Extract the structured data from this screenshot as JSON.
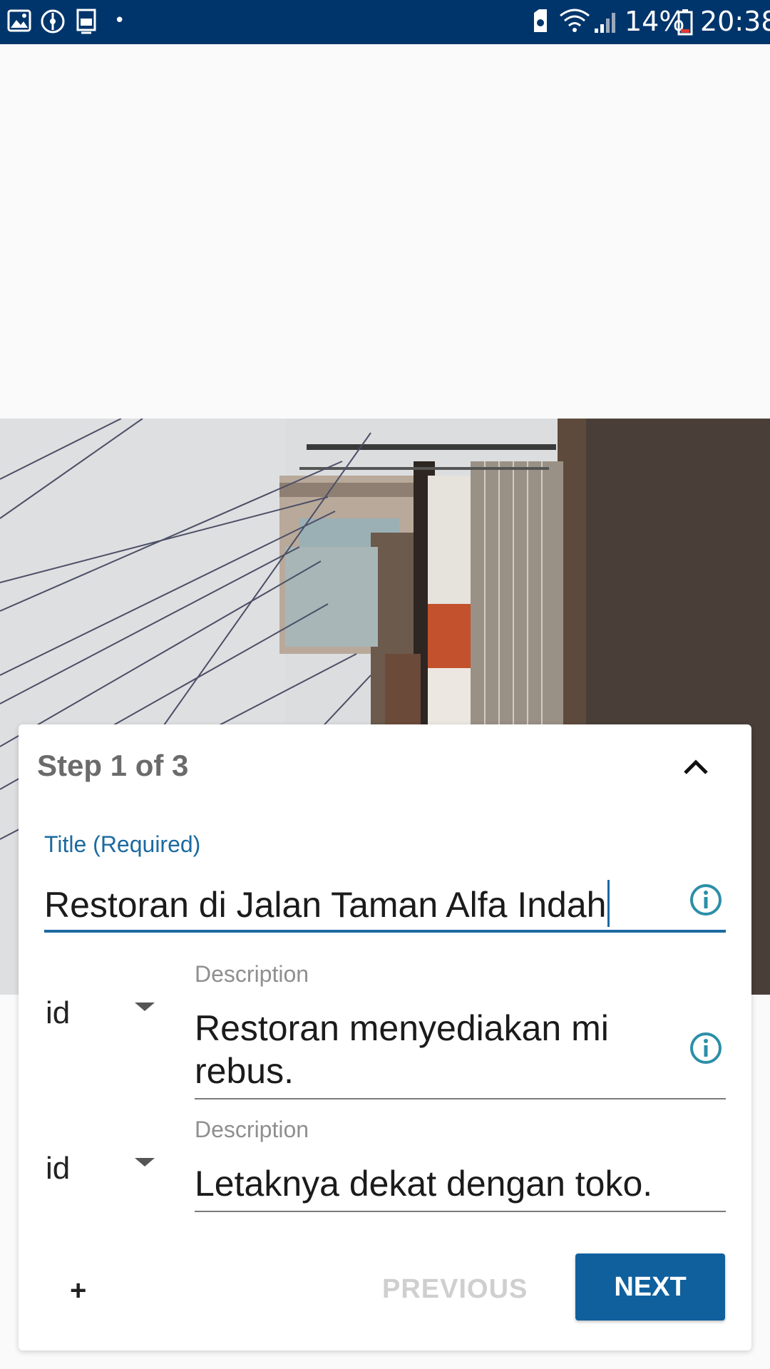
{
  "status_bar": {
    "battery": "14%",
    "time": "20:38",
    "dot": "•",
    "icons": [
      "image-icon",
      "compass-icon",
      "font-icon",
      "sim-icon",
      "wifi-icon",
      "signal-icon",
      "battery-icon"
    ]
  },
  "card": {
    "step": "Step 1 of 3",
    "title_field": {
      "label": "Title (Required)",
      "value": "Restoran di Jalan Taman Alfa Indah"
    },
    "descriptions": [
      {
        "language": "id",
        "label": "Description",
        "value": "Restoran menyediakan mi rebus."
      },
      {
        "language": "id",
        "label": "Description",
        "value": "Letaknya dekat dengan toko."
      }
    ],
    "add_label": "+",
    "previous_label": "PREVIOUS",
    "next_label": "NEXT"
  },
  "colors": {
    "status_bar": "#00356b",
    "accent": "#1c6aa0",
    "button": "#10609e",
    "info_icon": "#2c8fa8"
  }
}
